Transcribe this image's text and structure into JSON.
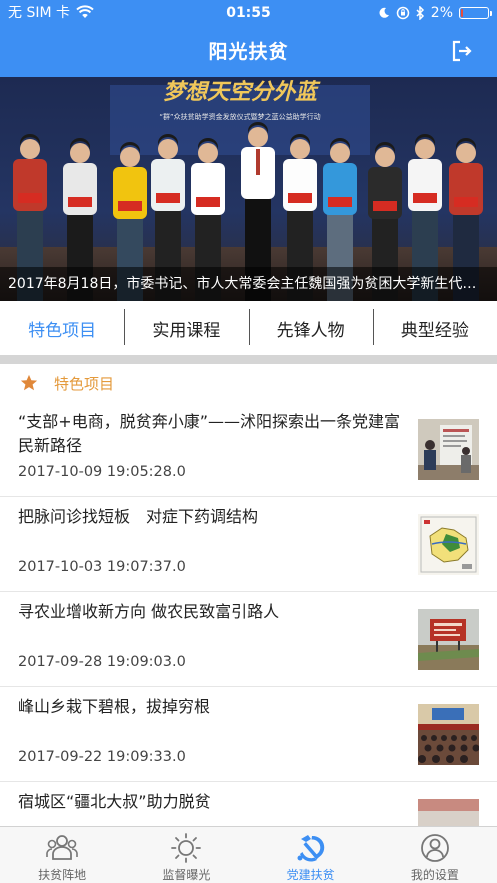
{
  "status_bar": {
    "carrier": "无 SIM 卡",
    "time": "01:55",
    "battery": "2%",
    "battery_level": 0.02,
    "icons": [
      "wifi-icon",
      "moon-icon",
      "rotation-lock-icon",
      "bluetooth-icon",
      "battery-icon"
    ]
  },
  "header": {
    "title": "阳光扶贫",
    "logout_icon": "logout-icon"
  },
  "banner": {
    "caption": "2017年8月18日，市委书记、市人大常委会主任魏国强为贫困大学新生代表发放助学金",
    "backdrop_title": "梦想天空分外蓝",
    "backdrop_subtitle": "“群”众扶贫助学资金发放仪式暨梦之蓝公益助学行动"
  },
  "tabs": [
    {
      "label": "特色项目",
      "active": true
    },
    {
      "label": "实用课程",
      "active": false
    },
    {
      "label": "先锋人物",
      "active": false
    },
    {
      "label": "典型经验",
      "active": false
    }
  ],
  "section": {
    "title": "特色项目",
    "icon": "star-icon",
    "color": "#e49a3c"
  },
  "articles": [
    {
      "title": "“支部+电商，脱贫奔小康”——沭阳探索出一条党建富民新路径",
      "date": "2017-10-09 19:05:28.0",
      "thumb": "meeting-photo"
    },
    {
      "title": "把脉问诊找短板　对症下药调结构",
      "date": "2017-10-03 19:07:37.0",
      "thumb": "map-image"
    },
    {
      "title": "寻农业增收新方向 做农民致富引路人",
      "date": "2017-09-28 19:09:03.0",
      "thumb": "field-sign-photo"
    },
    {
      "title": "峰山乡栽下碧根，拔掉穷根",
      "date": "2017-09-22 19:09:33.0",
      "thumb": "conference-photo"
    },
    {
      "title": "宿城区“疆北大叔”助力脱贫",
      "date": "",
      "thumb": "building-photo"
    }
  ],
  "tabbar": [
    {
      "label": "扶贫阵地",
      "icon": "group-icon",
      "active": false
    },
    {
      "label": "监督曝光",
      "icon": "sun-icon",
      "active": false
    },
    {
      "label": "党建扶贫",
      "icon": "party-emblem-icon",
      "active": true
    },
    {
      "label": "我的设置",
      "icon": "user-icon",
      "active": false
    }
  ],
  "colors": {
    "primary": "#3d8ff3",
    "accent": "#e49a3c",
    "divider": "#d5d5d5"
  }
}
